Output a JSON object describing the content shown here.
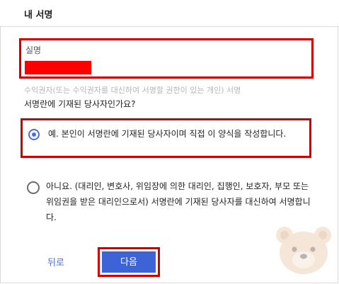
{
  "header": {
    "title": "내 서명"
  },
  "name_field": {
    "label": "실명"
  },
  "hint": "수익권자(또는 수익권자를 대신하여 서명할 권한이 있는 개인) 서명",
  "question": "서명란에 기재된 당사자인가요?",
  "options": [
    {
      "text": "예. 본인이 서명란에 기재된 당사자이며 직접 이 양식을 작성합니다.",
      "selected": true
    },
    {
      "text": "아니요. (대리인, 변호사, 위임장에 의한 대리인, 집행인, 보호자, 부모 또는 위임권을 받은 대리인으로서) 서명란에 기재된 당사자를 대신하여 서명합니다.",
      "selected": false
    }
  ],
  "footer": {
    "back_label": "뒤로",
    "next_label": "다음"
  },
  "colors": {
    "accent": "#3e63d6",
    "highlight": "#d10000",
    "redaction": "#ff0000"
  }
}
